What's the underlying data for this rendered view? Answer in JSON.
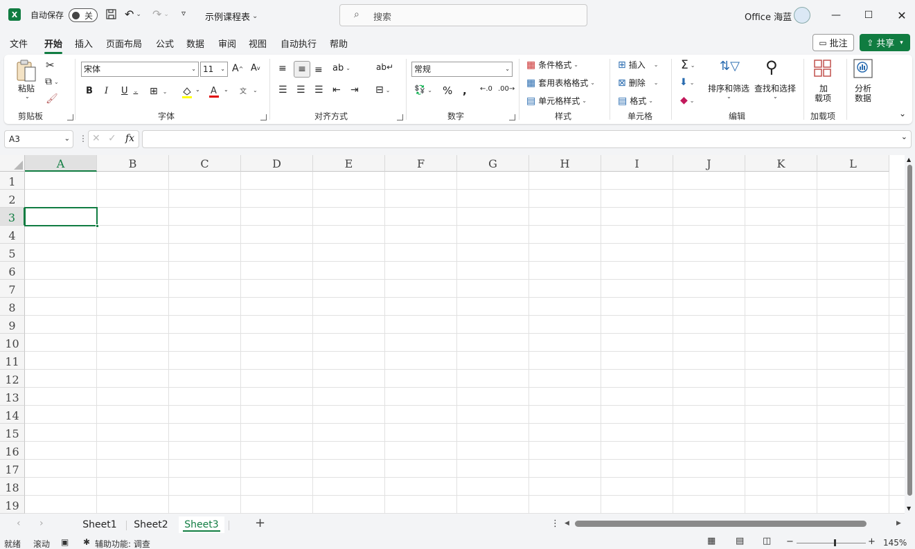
{
  "titlebar": {
    "autosave_label": "自动保存",
    "autosave_state": "关",
    "workbook_name": "示例课程表",
    "search_placeholder": "搜索",
    "user_name": "Office 海蓝"
  },
  "menu_tabs": [
    "文件",
    "开始",
    "插入",
    "页面布局",
    "公式",
    "数据",
    "审阅",
    "视图",
    "自动执行",
    "帮助"
  ],
  "active_tab": "开始",
  "header_buttons": {
    "comments": "批注",
    "share": "共享"
  },
  "ribbon": {
    "clipboard": {
      "paste": "粘贴",
      "group": "剪贴板"
    },
    "font": {
      "font_name": "宋体",
      "font_size": "11",
      "group": "字体",
      "bold": "B",
      "italic": "I",
      "underline": "U"
    },
    "alignment": {
      "group": "对齐方式"
    },
    "number": {
      "format": "常规",
      "group": "数字"
    },
    "styles": {
      "conditional": "条件格式",
      "table": "套用表格格式",
      "cell_styles": "单元格样式",
      "group": "样式"
    },
    "cells": {
      "insert": "插入",
      "delete": "删除",
      "format": "格式",
      "group": "单元格"
    },
    "editing": {
      "sort_filter": "排序和筛选",
      "find_select": "查找和选择",
      "group": "编辑"
    },
    "addins": {
      "addins_line1": "加",
      "addins_line2": "载项",
      "analyze_line1": "分析",
      "analyze_line2": "数据",
      "group": "加载项"
    }
  },
  "formula_bar": {
    "name_box": "A3",
    "formula": ""
  },
  "grid": {
    "columns": [
      "A",
      "B",
      "C",
      "D",
      "E",
      "F",
      "G",
      "H",
      "I",
      "J",
      "K",
      "L"
    ],
    "rows": [
      "1",
      "2",
      "3",
      "4",
      "5",
      "6",
      "7",
      "8",
      "9",
      "10",
      "11",
      "12",
      "13",
      "14",
      "15",
      "16",
      "17",
      "18",
      "19"
    ],
    "selected_cell": "A3"
  },
  "sheets": [
    "Sheet1",
    "Sheet2",
    "Sheet3"
  ],
  "active_sheet": "Sheet3",
  "status": {
    "ready": "就绪",
    "scroll": "滚动",
    "accessibility": "辅助功能: 调查",
    "zoom": "145%"
  },
  "colors": {
    "accent": "#107c41",
    "share_bg": "#107c41"
  }
}
